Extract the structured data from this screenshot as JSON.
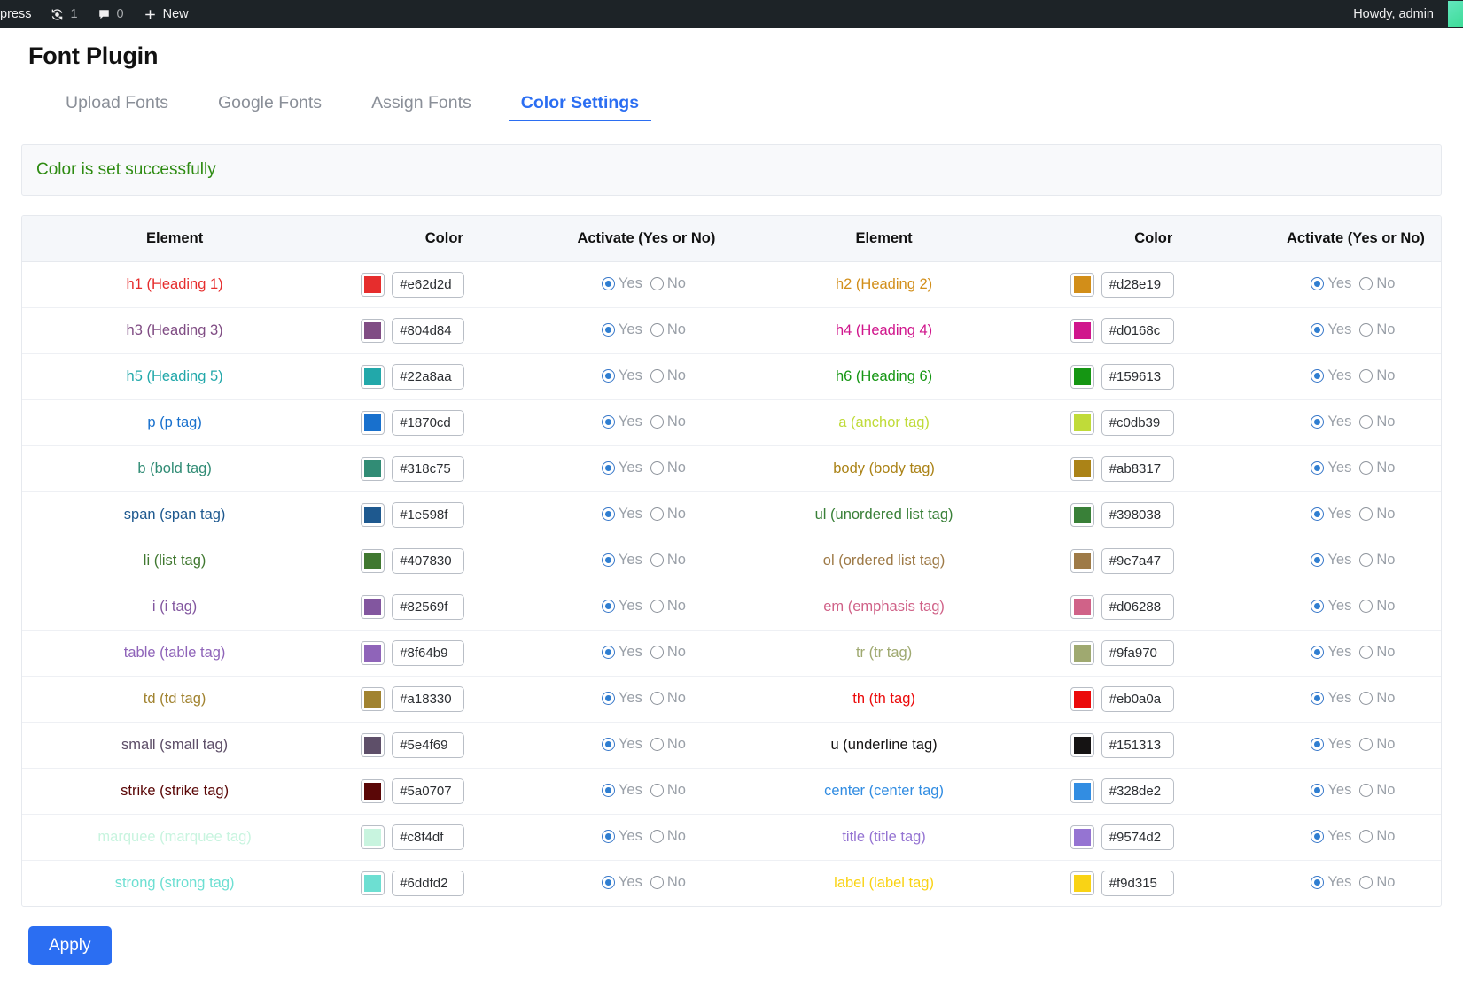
{
  "adminbar": {
    "site_name": "press",
    "updates_icon": "updates-icon",
    "updates_count": "1",
    "comments_icon": "comment-icon",
    "comments_count": "0",
    "new_icon": "plus-icon",
    "new_label": "New",
    "howdy": "Howdy, admin",
    "avatar": "avatar"
  },
  "header": {
    "title": "Font Plugin"
  },
  "tabs": [
    {
      "label": "Upload Fonts",
      "active": false
    },
    {
      "label": "Google Fonts",
      "active": false
    },
    {
      "label": "Assign Fonts",
      "active": false
    },
    {
      "label": "Color Settings",
      "active": true
    }
  ],
  "notice": {
    "text": "Color is set successfully",
    "color": "#2e8b12"
  },
  "table": {
    "headers": [
      "Element",
      "Color",
      "Activate (Yes or No)",
      "Element",
      "Color",
      "Activate (Yes or No)"
    ],
    "radio_yes_label": "Yes",
    "radio_no_label": "No",
    "rows": [
      {
        "left": {
          "element": "h1 (Heading 1)",
          "color": "#e62d2d",
          "activate": "Yes"
        },
        "right": {
          "element": "h2 (Heading 2)",
          "color": "#d28e19",
          "activate": "Yes"
        }
      },
      {
        "left": {
          "element": "h3 (Heading 3)",
          "color": "#804d84",
          "activate": "Yes"
        },
        "right": {
          "element": "h4 (Heading 4)",
          "color": "#d0168c",
          "activate": "Yes"
        }
      },
      {
        "left": {
          "element": "h5 (Heading 5)",
          "color": "#22a8aa",
          "activate": "Yes"
        },
        "right": {
          "element": "h6 (Heading 6)",
          "color": "#159613",
          "activate": "Yes"
        }
      },
      {
        "left": {
          "element": "p (p tag)",
          "color": "#1870cd",
          "activate": "Yes"
        },
        "right": {
          "element": "a (anchor tag)",
          "color": "#c0db39",
          "activate": "Yes"
        }
      },
      {
        "left": {
          "element": "b (bold tag)",
          "color": "#318c75",
          "activate": "Yes"
        },
        "right": {
          "element": "body (body tag)",
          "color": "#ab8317",
          "activate": "Yes"
        }
      },
      {
        "left": {
          "element": "span (span tag)",
          "color": "#1e598f",
          "activate": "Yes"
        },
        "right": {
          "element": "ul (unordered list tag)",
          "color": "#398038",
          "activate": "Yes"
        }
      },
      {
        "left": {
          "element": "li (list tag)",
          "color": "#407830",
          "activate": "Yes"
        },
        "right": {
          "element": "ol (ordered list tag)",
          "color": "#9e7a47",
          "activate": "Yes"
        }
      },
      {
        "left": {
          "element": "i (i tag)",
          "color": "#82569f",
          "activate": "Yes"
        },
        "right": {
          "element": "em (emphasis tag)",
          "color": "#d06288",
          "activate": "Yes"
        }
      },
      {
        "left": {
          "element": "table (table tag)",
          "color": "#8f64b9",
          "activate": "Yes"
        },
        "right": {
          "element": "tr (tr tag)",
          "color": "#9fa970",
          "activate": "Yes"
        }
      },
      {
        "left": {
          "element": "td (td tag)",
          "color": "#a18330",
          "activate": "Yes"
        },
        "right": {
          "element": "th (th tag)",
          "color": "#eb0a0a",
          "activate": "Yes"
        }
      },
      {
        "left": {
          "element": "small (small tag)",
          "color": "#5e4f69",
          "activate": "Yes"
        },
        "right": {
          "element": "u (underline tag)",
          "color": "#151313",
          "activate": "Yes"
        }
      },
      {
        "left": {
          "element": "strike (strike tag)",
          "color": "#5a0707",
          "activate": "Yes"
        },
        "right": {
          "element": "center (center tag)",
          "color": "#328de2",
          "activate": "Yes"
        }
      },
      {
        "left": {
          "element": "marquee (marquee tag)",
          "color": "#c8f4df",
          "activate": "Yes"
        },
        "right": {
          "element": "title (title tag)",
          "color": "#9574d2",
          "activate": "Yes"
        }
      },
      {
        "left": {
          "element": "strong (strong tag)",
          "color": "#6ddfd2",
          "activate": "Yes"
        },
        "right": {
          "element": "label (label tag)",
          "color": "#f9d315",
          "activate": "Yes"
        }
      }
    ]
  },
  "footer": {
    "apply_label": "Apply"
  },
  "theme": {
    "accent": "#2b6ef2",
    "tab_inactive": "#8a8f98",
    "header_bg": "#f5f7fa"
  }
}
